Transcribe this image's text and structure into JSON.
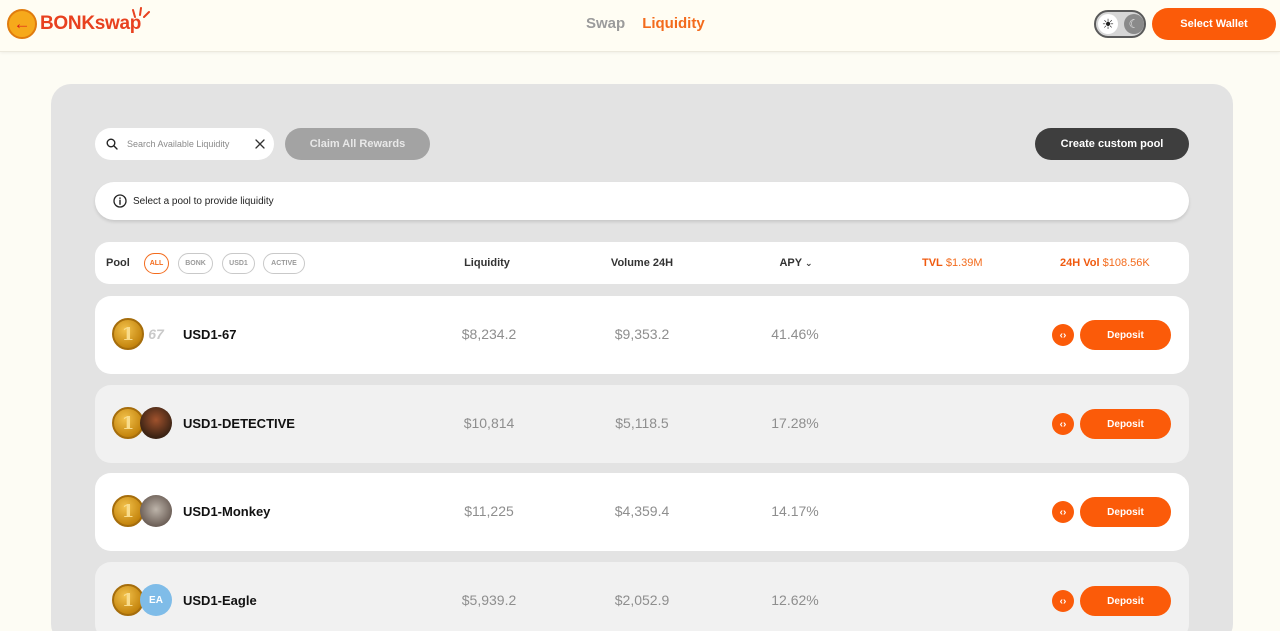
{
  "app": {
    "logo_text": "BONKswap"
  },
  "nav": {
    "swap": "Swap",
    "liquidity": "Liquidity",
    "active": "Liquidity"
  },
  "header": {
    "select_wallet": "Select Wallet",
    "theme": "light"
  },
  "toolbar": {
    "search_placeholder": "Search Available Liquidity",
    "search_value": "",
    "claim_all": "Claim All Rewards",
    "create_pool": "Create custom pool"
  },
  "info": {
    "message": "Select a pool to provide liquidity"
  },
  "table": {
    "pool_label": "Pool",
    "filters": [
      "ALL",
      "BONK",
      "USD1",
      "ACTIVE"
    ],
    "active_filter": "ALL",
    "columns": {
      "liquidity": "Liquidity",
      "volume": "Volume 24H",
      "apy": "APY"
    },
    "tvl_label": "TVL",
    "tvl_value": "$1.39M",
    "vol_label": "24H Vol",
    "vol_value": "$108.56K",
    "rows": [
      {
        "name": "USD1-67",
        "token_b_badge": "67",
        "liquidity": "$8,234.2",
        "volume": "$9,353.2",
        "apy": "41.46%",
        "deposit": "Deposit"
      },
      {
        "name": "USD1-DETECTIVE",
        "token_b_badge": "",
        "liquidity": "$10,814",
        "volume": "$5,118.5",
        "apy": "17.28%",
        "deposit": "Deposit"
      },
      {
        "name": "USD1-Monkey",
        "token_b_badge": "",
        "liquidity": "$11,225",
        "volume": "$4,359.4",
        "apy": "14.17%",
        "deposit": "Deposit"
      },
      {
        "name": "USD1-Eagle",
        "token_b_badge": "EA",
        "liquidity": "$5,939.2",
        "volume": "$2,052.9",
        "apy": "12.62%",
        "deposit": "Deposit"
      }
    ]
  },
  "colors": {
    "accent": "#fb5b09",
    "panel": "#e3e3e3",
    "page_bg": "#fdfcf4"
  }
}
